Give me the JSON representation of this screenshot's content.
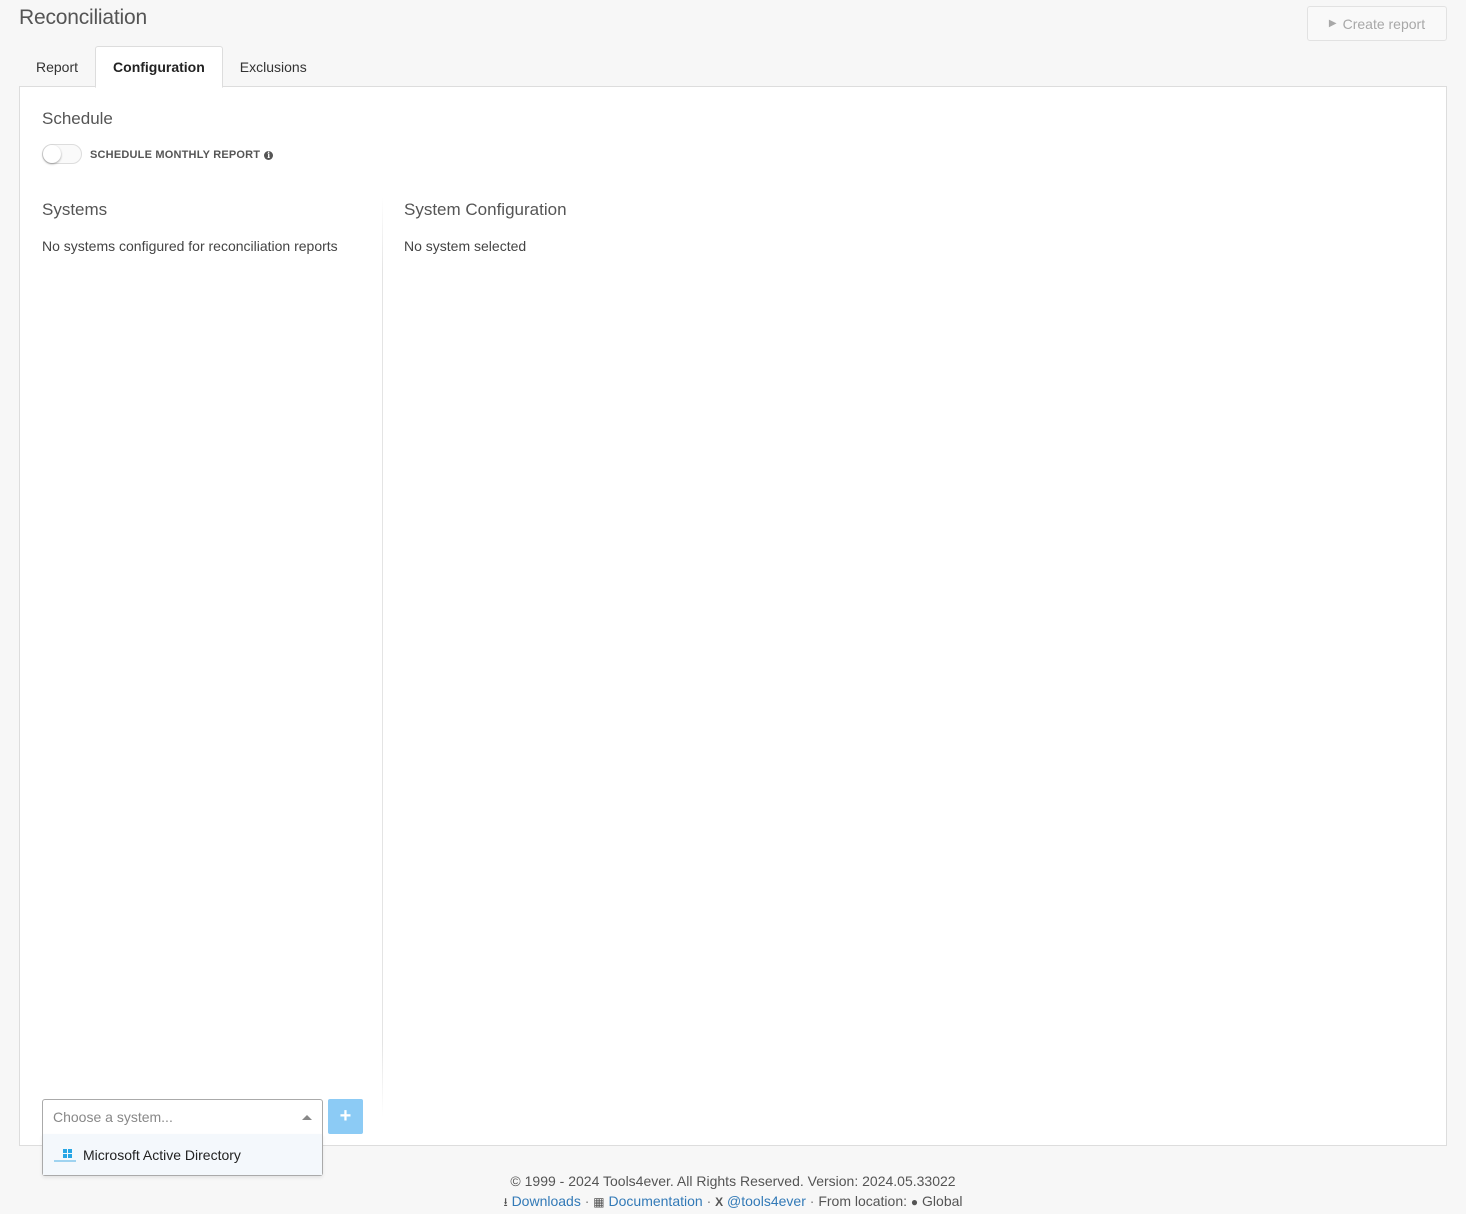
{
  "page": {
    "title": "Reconciliation",
    "create_report_label": "Create report"
  },
  "tabs": [
    {
      "label": "Report"
    },
    {
      "label": "Configuration",
      "active": true
    },
    {
      "label": "Exclusions"
    }
  ],
  "schedule": {
    "title": "Schedule",
    "toggle_label": "SCHEDULE MONTHLY REPORT",
    "toggle_on": false
  },
  "systems": {
    "title": "Systems",
    "empty_text": "No systems configured for reconciliation reports",
    "select_placeholder": "Choose a system...",
    "options": [
      {
        "label": "Microsoft Active Directory",
        "icon": "windows-icon"
      }
    ]
  },
  "system_configuration": {
    "title": "System Configuration",
    "empty_text": "No system selected"
  },
  "footer": {
    "copyright": "© 1999 - 2024 Tools4ever. All Rights Reserved. Version: 2024.05.33022",
    "downloads": "Downloads",
    "documentation": "Documentation",
    "twitter": "@tools4ever",
    "from_location_label": "From location:",
    "location": "Global"
  },
  "colors": {
    "accent": "#8ccbf5",
    "link": "#337ab7"
  }
}
